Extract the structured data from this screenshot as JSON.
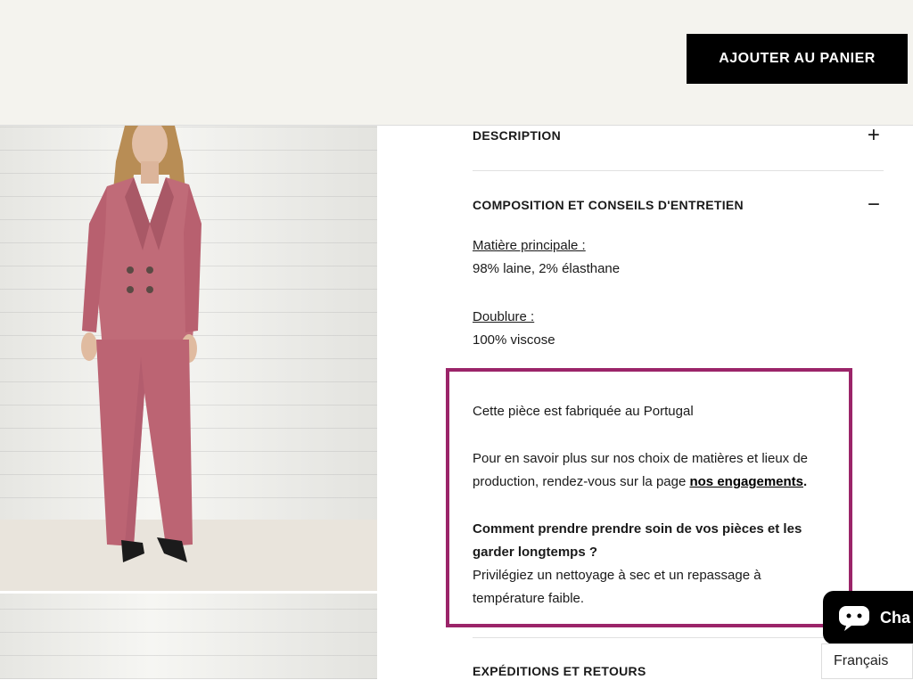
{
  "header": {
    "add_to_cart_label": "AJOUTER AU PANIER"
  },
  "accordion": {
    "description": {
      "label": "DESCRIPTION",
      "icon": "+"
    },
    "composition": {
      "label": "COMPOSITION ET CONSEILS D'ENTRETIEN",
      "icon": "−"
    },
    "shipping": {
      "label": "EXPÉDITIONS ET RETOURS"
    }
  },
  "composition": {
    "main_material_label": "Matière principale :",
    "main_material_value": "98% laine, 2% élasthane",
    "lining_label": "Doublure :",
    "lining_value": "100% viscose",
    "made_in": "Cette pièce est fabriquée au Portugal",
    "more_info_line1": "Pour en savoir plus sur nos choix de matières et lieux de",
    "more_info_line2": "production, rendez-vous sur la page",
    "engagements_link": "nos engagements",
    "period": ".",
    "care_title_line1": "Comment prendre prendre soin de vos pièces et les",
    "care_title_line2": "garder longtemps ?",
    "care_text_line1": "Privilégiez un nettoyage à sec et un repassage à",
    "care_text_line2": "température faible."
  },
  "chat": {
    "label": "Cha"
  },
  "language": {
    "selected": "Français"
  },
  "colors": {
    "highlight": "#9b2469",
    "suit": "#c06b78",
    "button": "#000000"
  }
}
